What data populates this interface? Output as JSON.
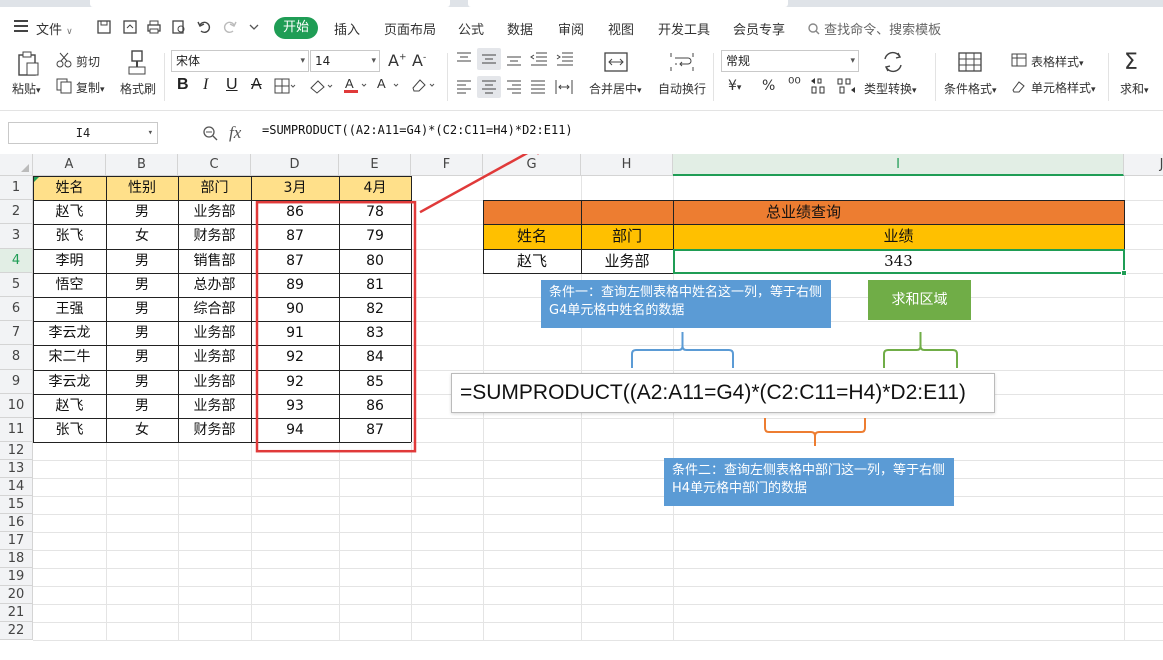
{
  "menu": {
    "file": "文件",
    "tabs": [
      "开始",
      "插入",
      "页面布局",
      "公式",
      "数据",
      "审阅",
      "视图",
      "开发工具",
      "会员专享"
    ],
    "search": "查找命令、搜索模板"
  },
  "ribbon": {
    "paste": "粘贴",
    "cut": "剪切",
    "copy": "复制",
    "format_painter": "格式刷",
    "font_name": "宋体",
    "font_size": "14",
    "merge_center": "合并居中",
    "wrap_text": "自动换行",
    "number_format": "常规",
    "type_convert": "类型转换",
    "conditional_format": "条件格式",
    "table_style": "表格样式",
    "cell_style": "单元格样式",
    "sum": "求和",
    "currency_symbol": "¥",
    "percent_symbol": "%"
  },
  "formula_bar": {
    "cell_ref": "I4",
    "fx": "fx",
    "formula": "=SUMPRODUCT((A2:A11=G4)*(C2:C11=H4)*D2:E11)"
  },
  "columns": [
    "A",
    "B",
    "C",
    "D",
    "E",
    "F",
    "G",
    "H",
    "I",
    "J"
  ],
  "rows": [
    "1",
    "2",
    "3",
    "4",
    "5",
    "6",
    "7",
    "8",
    "9",
    "10",
    "11",
    "12",
    "13",
    "14",
    "15",
    "16",
    "17",
    "18",
    "19",
    "20",
    "21",
    "22"
  ],
  "table": {
    "headers": [
      "姓名",
      "性别",
      "部门",
      "3月",
      "4月"
    ],
    "rows": [
      [
        "赵飞",
        "男",
        "业务部",
        "86",
        "78"
      ],
      [
        "张飞",
        "女",
        "财务部",
        "87",
        "79"
      ],
      [
        "李明",
        "男",
        "销售部",
        "87",
        "80"
      ],
      [
        "悟空",
        "男",
        "总办部",
        "89",
        "81"
      ],
      [
        "王强",
        "男",
        "综合部",
        "90",
        "82"
      ],
      [
        "李云龙",
        "男",
        "业务部",
        "91",
        "83"
      ],
      [
        "宋二牛",
        "男",
        "业务部",
        "92",
        "84"
      ],
      [
        "李云龙",
        "男",
        "业务部",
        "92",
        "85"
      ],
      [
        "赵飞",
        "男",
        "业务部",
        "93",
        "86"
      ],
      [
        "张飞",
        "女",
        "财务部",
        "94",
        "87"
      ]
    ]
  },
  "query": {
    "title": "总业绩查询",
    "headers": [
      "姓名",
      "部门",
      "业绩"
    ],
    "values": [
      "赵飞",
      "业务部",
      "343"
    ]
  },
  "annotations": {
    "cond1": "条件一：查询左侧表格中姓名这一列，等于右侧G4单元格中姓名的数据",
    "sum_area": "求和区域",
    "formula_big": "=SUMPRODUCT((A2:A11=G4)*(C2:C11=H4)*D2:E11)",
    "cond2": "条件二：查询左侧表格中部门这一列，等于右侧H4单元格中部门的数据"
  },
  "colors": {
    "accent_green": "#1f9d55",
    "header_fill": "#ffe08a",
    "query_title_fill": "#ed7d31",
    "query_header_fill": "#ffc000",
    "callout_blue": "#5b9bd5",
    "callout_green": "#70ad47",
    "highlight_red": "#e03a3a"
  }
}
